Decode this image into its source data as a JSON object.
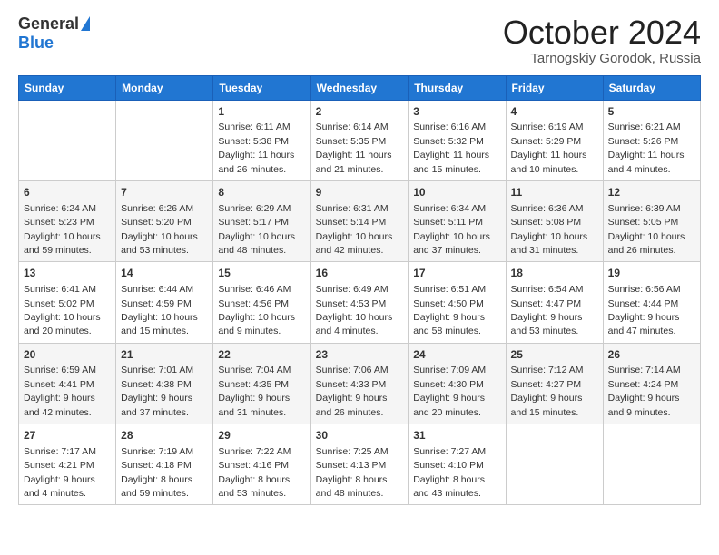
{
  "logo": {
    "general": "General",
    "blue": "Blue"
  },
  "title": "October 2024",
  "location": "Tarnogskiy Gorodok, Russia",
  "days_of_week": [
    "Sunday",
    "Monday",
    "Tuesday",
    "Wednesday",
    "Thursday",
    "Friday",
    "Saturday"
  ],
  "weeks": [
    [
      {
        "day": "",
        "sunrise": "",
        "sunset": "",
        "daylight": ""
      },
      {
        "day": "",
        "sunrise": "",
        "sunset": "",
        "daylight": ""
      },
      {
        "day": "1",
        "sunrise": "Sunrise: 6:11 AM",
        "sunset": "Sunset: 5:38 PM",
        "daylight": "Daylight: 11 hours and 26 minutes."
      },
      {
        "day": "2",
        "sunrise": "Sunrise: 6:14 AM",
        "sunset": "Sunset: 5:35 PM",
        "daylight": "Daylight: 11 hours and 21 minutes."
      },
      {
        "day": "3",
        "sunrise": "Sunrise: 6:16 AM",
        "sunset": "Sunset: 5:32 PM",
        "daylight": "Daylight: 11 hours and 15 minutes."
      },
      {
        "day": "4",
        "sunrise": "Sunrise: 6:19 AM",
        "sunset": "Sunset: 5:29 PM",
        "daylight": "Daylight: 11 hours and 10 minutes."
      },
      {
        "day": "5",
        "sunrise": "Sunrise: 6:21 AM",
        "sunset": "Sunset: 5:26 PM",
        "daylight": "Daylight: 11 hours and 4 minutes."
      }
    ],
    [
      {
        "day": "6",
        "sunrise": "Sunrise: 6:24 AM",
        "sunset": "Sunset: 5:23 PM",
        "daylight": "Daylight: 10 hours and 59 minutes."
      },
      {
        "day": "7",
        "sunrise": "Sunrise: 6:26 AM",
        "sunset": "Sunset: 5:20 PM",
        "daylight": "Daylight: 10 hours and 53 minutes."
      },
      {
        "day": "8",
        "sunrise": "Sunrise: 6:29 AM",
        "sunset": "Sunset: 5:17 PM",
        "daylight": "Daylight: 10 hours and 48 minutes."
      },
      {
        "day": "9",
        "sunrise": "Sunrise: 6:31 AM",
        "sunset": "Sunset: 5:14 PM",
        "daylight": "Daylight: 10 hours and 42 minutes."
      },
      {
        "day": "10",
        "sunrise": "Sunrise: 6:34 AM",
        "sunset": "Sunset: 5:11 PM",
        "daylight": "Daylight: 10 hours and 37 minutes."
      },
      {
        "day": "11",
        "sunrise": "Sunrise: 6:36 AM",
        "sunset": "Sunset: 5:08 PM",
        "daylight": "Daylight: 10 hours and 31 minutes."
      },
      {
        "day": "12",
        "sunrise": "Sunrise: 6:39 AM",
        "sunset": "Sunset: 5:05 PM",
        "daylight": "Daylight: 10 hours and 26 minutes."
      }
    ],
    [
      {
        "day": "13",
        "sunrise": "Sunrise: 6:41 AM",
        "sunset": "Sunset: 5:02 PM",
        "daylight": "Daylight: 10 hours and 20 minutes."
      },
      {
        "day": "14",
        "sunrise": "Sunrise: 6:44 AM",
        "sunset": "Sunset: 4:59 PM",
        "daylight": "Daylight: 10 hours and 15 minutes."
      },
      {
        "day": "15",
        "sunrise": "Sunrise: 6:46 AM",
        "sunset": "Sunset: 4:56 PM",
        "daylight": "Daylight: 10 hours and 9 minutes."
      },
      {
        "day": "16",
        "sunrise": "Sunrise: 6:49 AM",
        "sunset": "Sunset: 4:53 PM",
        "daylight": "Daylight: 10 hours and 4 minutes."
      },
      {
        "day": "17",
        "sunrise": "Sunrise: 6:51 AM",
        "sunset": "Sunset: 4:50 PM",
        "daylight": "Daylight: 9 hours and 58 minutes."
      },
      {
        "day": "18",
        "sunrise": "Sunrise: 6:54 AM",
        "sunset": "Sunset: 4:47 PM",
        "daylight": "Daylight: 9 hours and 53 minutes."
      },
      {
        "day": "19",
        "sunrise": "Sunrise: 6:56 AM",
        "sunset": "Sunset: 4:44 PM",
        "daylight": "Daylight: 9 hours and 47 minutes."
      }
    ],
    [
      {
        "day": "20",
        "sunrise": "Sunrise: 6:59 AM",
        "sunset": "Sunset: 4:41 PM",
        "daylight": "Daylight: 9 hours and 42 minutes."
      },
      {
        "day": "21",
        "sunrise": "Sunrise: 7:01 AM",
        "sunset": "Sunset: 4:38 PM",
        "daylight": "Daylight: 9 hours and 37 minutes."
      },
      {
        "day": "22",
        "sunrise": "Sunrise: 7:04 AM",
        "sunset": "Sunset: 4:35 PM",
        "daylight": "Daylight: 9 hours and 31 minutes."
      },
      {
        "day": "23",
        "sunrise": "Sunrise: 7:06 AM",
        "sunset": "Sunset: 4:33 PM",
        "daylight": "Daylight: 9 hours and 26 minutes."
      },
      {
        "day": "24",
        "sunrise": "Sunrise: 7:09 AM",
        "sunset": "Sunset: 4:30 PM",
        "daylight": "Daylight: 9 hours and 20 minutes."
      },
      {
        "day": "25",
        "sunrise": "Sunrise: 7:12 AM",
        "sunset": "Sunset: 4:27 PM",
        "daylight": "Daylight: 9 hours and 15 minutes."
      },
      {
        "day": "26",
        "sunrise": "Sunrise: 7:14 AM",
        "sunset": "Sunset: 4:24 PM",
        "daylight": "Daylight: 9 hours and 9 minutes."
      }
    ],
    [
      {
        "day": "27",
        "sunrise": "Sunrise: 7:17 AM",
        "sunset": "Sunset: 4:21 PM",
        "daylight": "Daylight: 9 hours and 4 minutes."
      },
      {
        "day": "28",
        "sunrise": "Sunrise: 7:19 AM",
        "sunset": "Sunset: 4:18 PM",
        "daylight": "Daylight: 8 hours and 59 minutes."
      },
      {
        "day": "29",
        "sunrise": "Sunrise: 7:22 AM",
        "sunset": "Sunset: 4:16 PM",
        "daylight": "Daylight: 8 hours and 53 minutes."
      },
      {
        "day": "30",
        "sunrise": "Sunrise: 7:25 AM",
        "sunset": "Sunset: 4:13 PM",
        "daylight": "Daylight: 8 hours and 48 minutes."
      },
      {
        "day": "31",
        "sunrise": "Sunrise: 7:27 AM",
        "sunset": "Sunset: 4:10 PM",
        "daylight": "Daylight: 8 hours and 43 minutes."
      },
      {
        "day": "",
        "sunrise": "",
        "sunset": "",
        "daylight": ""
      },
      {
        "day": "",
        "sunrise": "",
        "sunset": "",
        "daylight": ""
      }
    ]
  ]
}
